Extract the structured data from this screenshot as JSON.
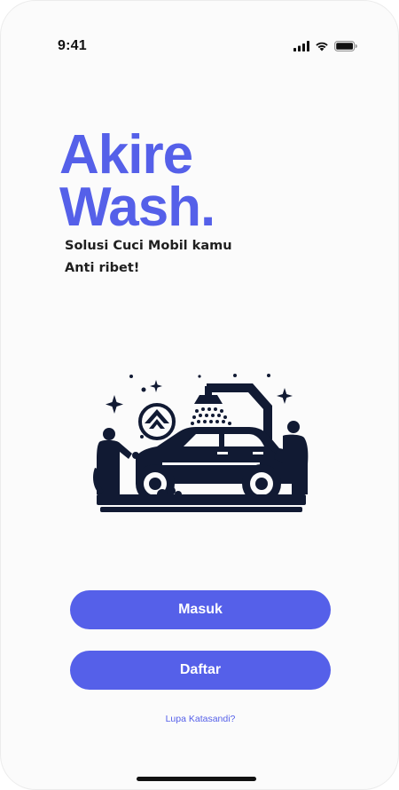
{
  "status_bar": {
    "time": "9:41",
    "icons": [
      "cellular-signal-icon",
      "wifi-icon",
      "battery-icon"
    ]
  },
  "app": {
    "title_line1": "Akire",
    "title_line2": "Wash.",
    "tagline_line1": "Solusi Cuci Mobil kamu",
    "tagline_line2": "Anti ribet!"
  },
  "illustration": {
    "icon": "car-wash-illustration"
  },
  "actions": {
    "login_label": "Masuk",
    "register_label": "Daftar",
    "forgot_password_label": "Lupa Katasandi?"
  },
  "colors": {
    "brand": "#5560e9",
    "background": "#fbfbfb",
    "illustration": "#111a33",
    "text": "#1f1f1f"
  }
}
